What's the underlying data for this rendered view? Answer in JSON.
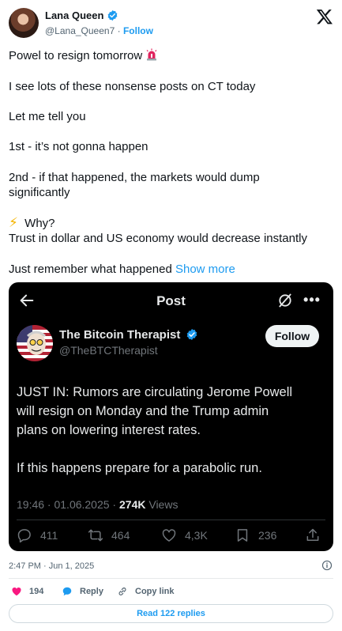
{
  "author": {
    "name": "Lana Queen",
    "handle": "@Lana_Queen7",
    "separator": "·",
    "follow_label": "Follow"
  },
  "tweet": {
    "line1": "Powel to resign tomorrow",
    "line2": "I see lots of these nonsense posts on CT today",
    "line3": "Let me tell you",
    "line4": "1st - it’s not gonna happen",
    "line5a": "2nd - if that happened, the markets would dump",
    "line5b": "significantly",
    "line6a": "Why?",
    "line6b": "Trust in dollar and US economy would decrease instantly",
    "line7": "Just remember what happened",
    "show_more": "Show more"
  },
  "embed": {
    "title": "Post",
    "name": "The Bitcoin Therapist",
    "handle": "@TheBTCTherapist",
    "follow_label": "Follow",
    "body1a": "JUST IN: Rumors are circulating Jerome Powell",
    "body1b": "will resign on Monday and the Trump admin",
    "body1c": "plans on lowering interest rates.",
    "body2": "If this happens prepare for a parabolic run.",
    "time_date": "19:46 · 01.06.2025 · ",
    "views_count": "274K",
    "views_label": " Views",
    "replies": "411",
    "reposts": "464",
    "likes": "4,3K",
    "bookmarks": "236"
  },
  "footer": {
    "timestamp": "2:47 PM · Jun 1, 2025",
    "likes": "194",
    "reply_label": "Reply",
    "copy_link_label": "Copy link",
    "read_replies": "Read 122 replies"
  },
  "colors": {
    "accent": "#1d9bf0",
    "heart": "#f91880",
    "embed_bg": "#000000",
    "text": "#0f1419",
    "muted": "#536471"
  },
  "icons": [
    "verified-badge-icon",
    "x-logo-icon",
    "siren-emoji-icon",
    "lightning-emoji-icon",
    "back-arrow-icon",
    "grok-icon",
    "more-icon",
    "reply-icon",
    "repost-icon",
    "like-icon",
    "bookmark-icon",
    "share-icon",
    "info-icon",
    "heart-icon",
    "chat-bubble-icon",
    "link-icon"
  ]
}
